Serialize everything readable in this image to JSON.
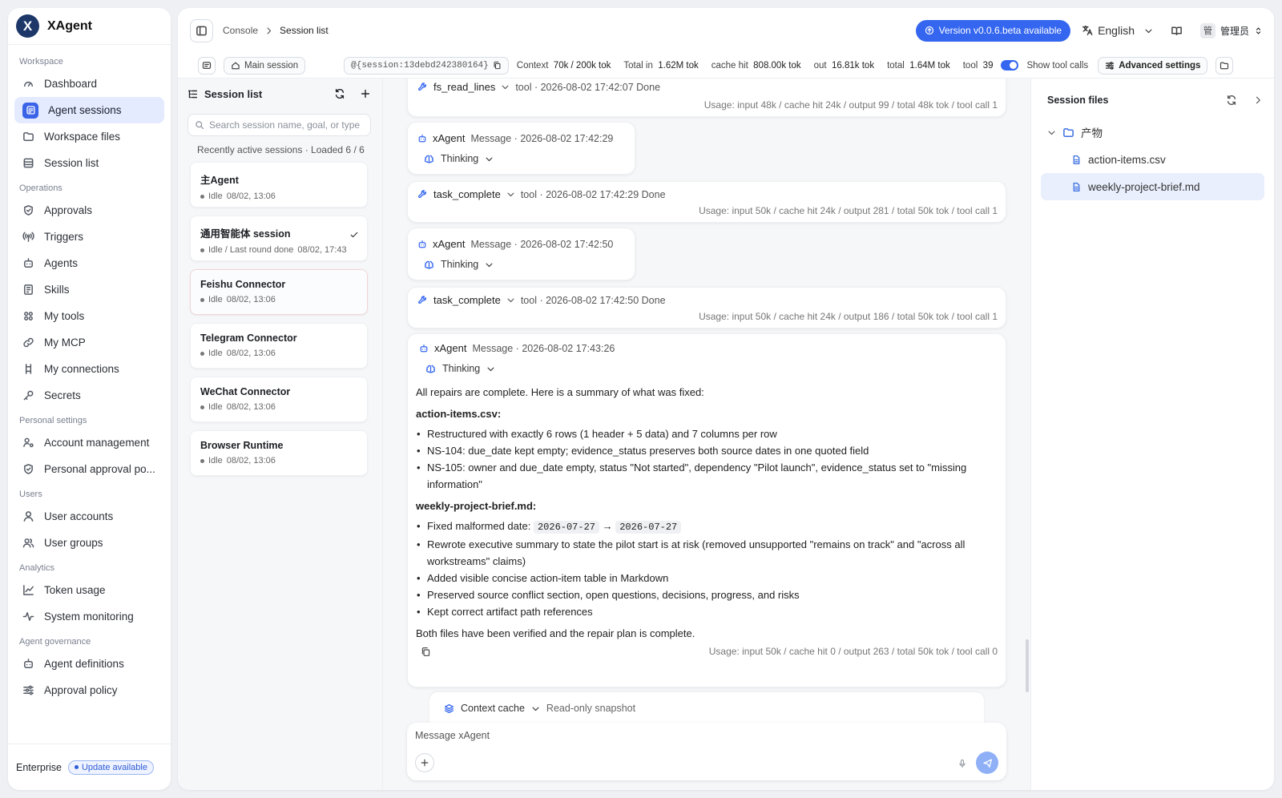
{
  "app": {
    "name": "XAgent",
    "logo_letter": "X"
  },
  "sidebar": {
    "sections": [
      {
        "title": "Workspace",
        "items": [
          {
            "label": "Dashboard",
            "icon": "gauge-icon"
          },
          {
            "label": "Agent sessions",
            "icon": "chat-icon",
            "active": true
          },
          {
            "label": "Workspace files",
            "icon": "folder-icon"
          },
          {
            "label": "Session list",
            "icon": "list-icon"
          }
        ]
      },
      {
        "title": "Operations",
        "items": [
          {
            "label": "Approvals",
            "icon": "shield-check-icon"
          },
          {
            "label": "Triggers",
            "icon": "broadcast-icon"
          },
          {
            "label": "Agents",
            "icon": "bot-icon"
          },
          {
            "label": "Skills",
            "icon": "book-icon"
          },
          {
            "label": "My tools",
            "icon": "tools-icon"
          },
          {
            "label": "My MCP",
            "icon": "link-icon"
          },
          {
            "label": "My connections",
            "icon": "connections-icon"
          },
          {
            "label": "Secrets",
            "icon": "key-icon"
          }
        ]
      },
      {
        "title": "Personal settings",
        "items": [
          {
            "label": "Account management",
            "icon": "user-gear-icon"
          },
          {
            "label": "Personal approval po...",
            "icon": "shield-icon"
          }
        ]
      },
      {
        "title": "Users",
        "items": [
          {
            "label": "User accounts",
            "icon": "user-icon"
          },
          {
            "label": "User groups",
            "icon": "users-icon"
          }
        ]
      },
      {
        "title": "Analytics",
        "items": [
          {
            "label": "Token usage",
            "icon": "chart-line-icon"
          },
          {
            "label": "System monitoring",
            "icon": "activity-icon"
          }
        ]
      },
      {
        "title": "Agent governance",
        "items": [
          {
            "label": "Agent definitions",
            "icon": "bot-icon"
          },
          {
            "label": "Approval policy",
            "icon": "sliders-icon"
          }
        ]
      }
    ],
    "footer": {
      "edition": "Enterprise",
      "update": "Update available"
    }
  },
  "topbar": {
    "breadcrumb": [
      "Console",
      "Session list"
    ],
    "version_badge": "Version v0.0.6.beta available",
    "language": "English",
    "user_avatar": "管",
    "user_name": "管理员"
  },
  "statbar": {
    "main_session": "Main session",
    "session_ref": "@{session:13debd242380164}",
    "context_label": "Context",
    "context_value": "70k / 200k tok",
    "total_in_label": "Total  in",
    "total_in_value": "1.62M tok",
    "cache_hit_label": "cache hit",
    "cache_hit_value": "808.00k tok",
    "out_label": "out",
    "out_value": "16.81k tok",
    "total_label": "total",
    "total_value": "1.64M tok",
    "tool_label": "tool",
    "tool_value": "39",
    "show_tool_calls": "Show tool calls",
    "show_tool_calls_on": true,
    "advanced": "Advanced settings"
  },
  "session_list": {
    "title": "Session list",
    "search_placeholder": "Search session name, goal, or type",
    "recent": "Recently active sessions · Loaded 6 / 6",
    "sessions": [
      {
        "name": "主Agent",
        "status": "Idle",
        "time": "08/02, 13:06"
      },
      {
        "name": "通用智能体 session",
        "status": "Idle / Last round done",
        "time": "08/02, 17:43",
        "checked": true
      },
      {
        "name": "Feishu Connector",
        "status": "Idle",
        "time": "08/02, 13:06",
        "selected": true
      },
      {
        "name": "Telegram Connector",
        "status": "Idle",
        "time": "08/02, 13:06"
      },
      {
        "name": "WeChat Connector",
        "status": "Idle",
        "time": "08/02, 13:06"
      },
      {
        "name": "Browser Runtime",
        "status": "Idle",
        "time": "08/02, 13:06"
      }
    ]
  },
  "chat": {
    "tool1": {
      "name": "fs_read_lines",
      "meta": "tool · 2026-08-02 17:42:07  Done",
      "usage": "Usage: input 48k / cache hit 24k / output 99 / total 48k tok / tool call 1"
    },
    "msg1": {
      "name": "xAgent",
      "meta": "Message · 2026-08-02 17:42:29",
      "thinking": "Thinking"
    },
    "tool2": {
      "name": "task_complete",
      "meta": "tool · 2026-08-02 17:42:29  Done",
      "usage": "Usage: input 50k / cache hit 24k / output 281 / total 50k tok / tool call 1"
    },
    "msg2": {
      "name": "xAgent",
      "meta": "Message · 2026-08-02 17:42:50",
      "thinking": "Thinking"
    },
    "tool3": {
      "name": "task_complete",
      "meta": "tool · 2026-08-02 17:42:50  Done",
      "usage": "Usage: input 50k / cache hit 24k / output 186 / total 50k tok / tool call 1"
    },
    "msg3": {
      "name": "xAgent",
      "meta": "Message · 2026-08-02 17:43:26",
      "thinking": "Thinking",
      "intro": "All repairs are complete. Here is a summary of what was fixed:",
      "h1": "action-items.csv:",
      "b1": "Restructured with exactly 6 rows (1 header + 5 data) and 7 columns per row",
      "b2": "NS-104: due_date kept empty; evidence_status preserves both source dates in one quoted field",
      "b3": "NS-105: owner and due_date empty, status \"Not started\", dependency \"Pilot launch\", evidence_status set to \"missing information\"",
      "h2": "weekly-project-brief.md:",
      "b4_prefix": "Fixed malformed date:",
      "b4_from": "2026-07-27",
      "b4_arrow": "→",
      "b4_to": "2026-07-27",
      "b5": "Rewrote executive summary to state the pilot start is at risk (removed unsupported \"remains on track\" and \"across all workstreams\" claims)",
      "b6": "Added visible concise action-item table in Markdown",
      "b7": "Preserved source conflict section, open questions, decisions, progress, and risks",
      "b8": "Kept correct artifact path references",
      "outro": "Both files have been verified and the repair plan is complete.",
      "usage": "Usage: input 50k / cache hit 0 / output 263 / total 50k tok / tool call 0"
    },
    "context_cache": "Context cache",
    "read_only": "Read-only snapshot",
    "composer_placeholder": "Message xAgent"
  },
  "files": {
    "title": "Session files",
    "folder": "产物",
    "items": [
      "action-items.csv",
      "weekly-project-brief.md"
    ]
  },
  "colors": {
    "accent": "#3466f0",
    "active_bg": "#e4ebff",
    "logo": "#1c3768"
  }
}
